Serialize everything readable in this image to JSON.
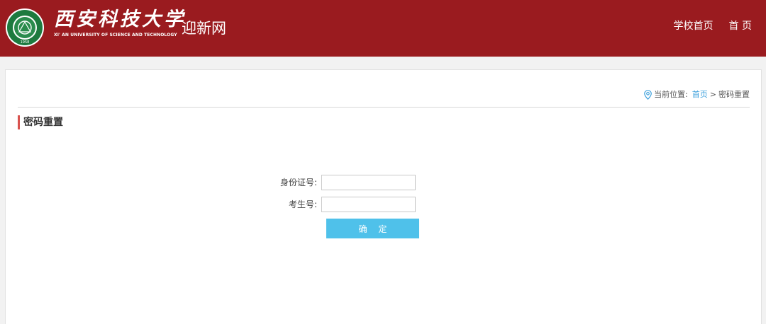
{
  "header": {
    "brand_cn": "西安科技大学",
    "brand_en": "XI' AN UNIVERSITY OF SCIENCE AND TECHNOLOGY",
    "site_name": "迎新网",
    "seal_year": "1958",
    "nav": [
      {
        "label": "学校首页"
      },
      {
        "label": "首 页"
      }
    ]
  },
  "breadcrumb": {
    "prefix": "当前位置:",
    "home": "首页",
    "separator": ">",
    "current": "密码重置"
  },
  "section": {
    "title": "密码重置"
  },
  "form": {
    "fields": [
      {
        "label": "身份证号:",
        "value": "",
        "placeholder": ""
      },
      {
        "label": "考生号:",
        "value": "",
        "placeholder": ""
      }
    ],
    "submit_label": "确 定"
  },
  "colors": {
    "header_bg": "#9a1b1f",
    "accent_bar": "#d9534f",
    "button_bg": "#4fc1ea",
    "link": "#3b9fdc"
  }
}
